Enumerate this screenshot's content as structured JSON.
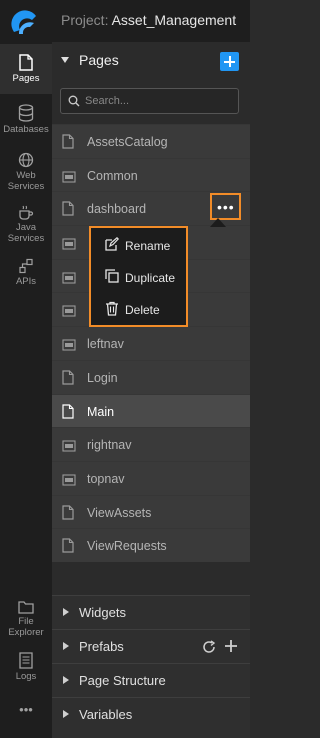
{
  "project": {
    "prefix": "Project:",
    "name": "Asset_Management"
  },
  "rail": {
    "pages": "Pages",
    "databases": "Databases",
    "web_services_1": "Web",
    "web_services_2": "Services",
    "java_services_1": "Java",
    "java_services_2": "Services",
    "apis": "APIs",
    "file_explorer_1": "File",
    "file_explorer_2": "Explorer",
    "logs": "Logs",
    "more": "•••"
  },
  "pages_panel": {
    "title": "Pages",
    "search_placeholder": "Search...",
    "items": [
      {
        "label": "AssetsCatalog",
        "icon": "page-icon"
      },
      {
        "label": "Common",
        "icon": "partial-icon"
      },
      {
        "label": "dashboard",
        "icon": "page-icon"
      },
      {
        "label": "",
        "icon": "partial-icon"
      },
      {
        "label": "",
        "icon": "partial-icon"
      },
      {
        "label": "",
        "icon": "partial-icon"
      },
      {
        "label": "leftnav",
        "icon": "partial-icon"
      },
      {
        "label": "Login",
        "icon": "page-icon"
      },
      {
        "label": "Main",
        "icon": "page-icon",
        "selected": true
      },
      {
        "label": "rightnav",
        "icon": "partial-icon"
      },
      {
        "label": "topnav",
        "icon": "partial-icon"
      },
      {
        "label": "ViewAssets",
        "icon": "page-icon"
      },
      {
        "label": "ViewRequests",
        "icon": "page-icon"
      }
    ],
    "more_dots": "•••"
  },
  "context_menu": {
    "rename": "Rename",
    "duplicate": "Duplicate",
    "delete": "Delete"
  },
  "sections": {
    "widgets": "Widgets",
    "prefabs": "Prefabs",
    "page_structure": "Page Structure",
    "variables": "Variables"
  },
  "colors": {
    "accent": "#2196f3",
    "highlight": "#f28c28"
  }
}
